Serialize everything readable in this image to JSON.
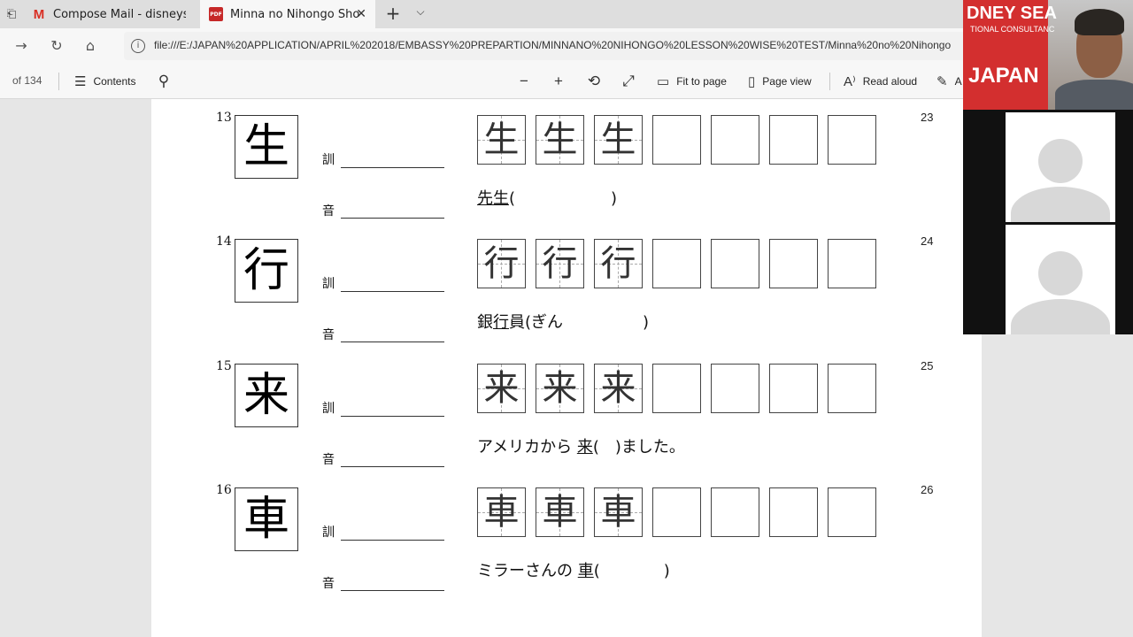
{
  "browser": {
    "tabs": [
      {
        "title": "Compose Mail - disneyseap",
        "icon": "gmail-icon",
        "active": false
      },
      {
        "title": "Minna no Nihongo Sho",
        "icon": "pdf-icon",
        "active": true
      }
    ],
    "new_tab_symbol": "+",
    "tab_list_symbol": "⌵",
    "url": "file:///E:/JAPAN%20APPLICATION/APRIL%202018/EMBASSY%20PREPARTION/MINNANO%20NIHONGO%20LESSON%20WISE%20TEST/Minna%20no%20Nihongo"
  },
  "pdf_toolbar": {
    "page_of": "of 134",
    "contents_label": "Contents",
    "fit_label": "Fit to page",
    "page_view_label": "Page view",
    "read_aloud_label": "Read aloud",
    "overflow_label": "A"
  },
  "document": {
    "kun_label": "訓",
    "on_label": "音",
    "exercises": [
      {
        "num": "13",
        "kanji": "生",
        "page": "23",
        "sentence_parts": [
          "先生",
          "(",
          "",
          ")"
        ],
        "sentence_pre": "",
        "underline": "先生",
        "paren_open": "(",
        "paren_close": ")",
        "gap": "　　　　　　"
      },
      {
        "num": "14",
        "kanji": "行",
        "page": "24",
        "sentence_pre": "銀",
        "underline": "行",
        "sentence_post": "員(ぎん",
        "paren_close": "　　　　　)"
      },
      {
        "num": "15",
        "kanji": "来",
        "page": "25",
        "sentence_pre": "アメリカから ",
        "underline": "来",
        "sentence_post": "(",
        "paren_close": "　)ました。"
      },
      {
        "num": "16",
        "kanji": "車",
        "page": "26",
        "sentence_pre": "ミラーさんの ",
        "underline": "車",
        "sentence_post": "(",
        "paren_close": "　　　　)"
      }
    ]
  },
  "video": {
    "banner_title": "DNEY SEA",
    "banner_sub": "TIONAL CONSULTANC",
    "banner_big": "JAPAN"
  }
}
